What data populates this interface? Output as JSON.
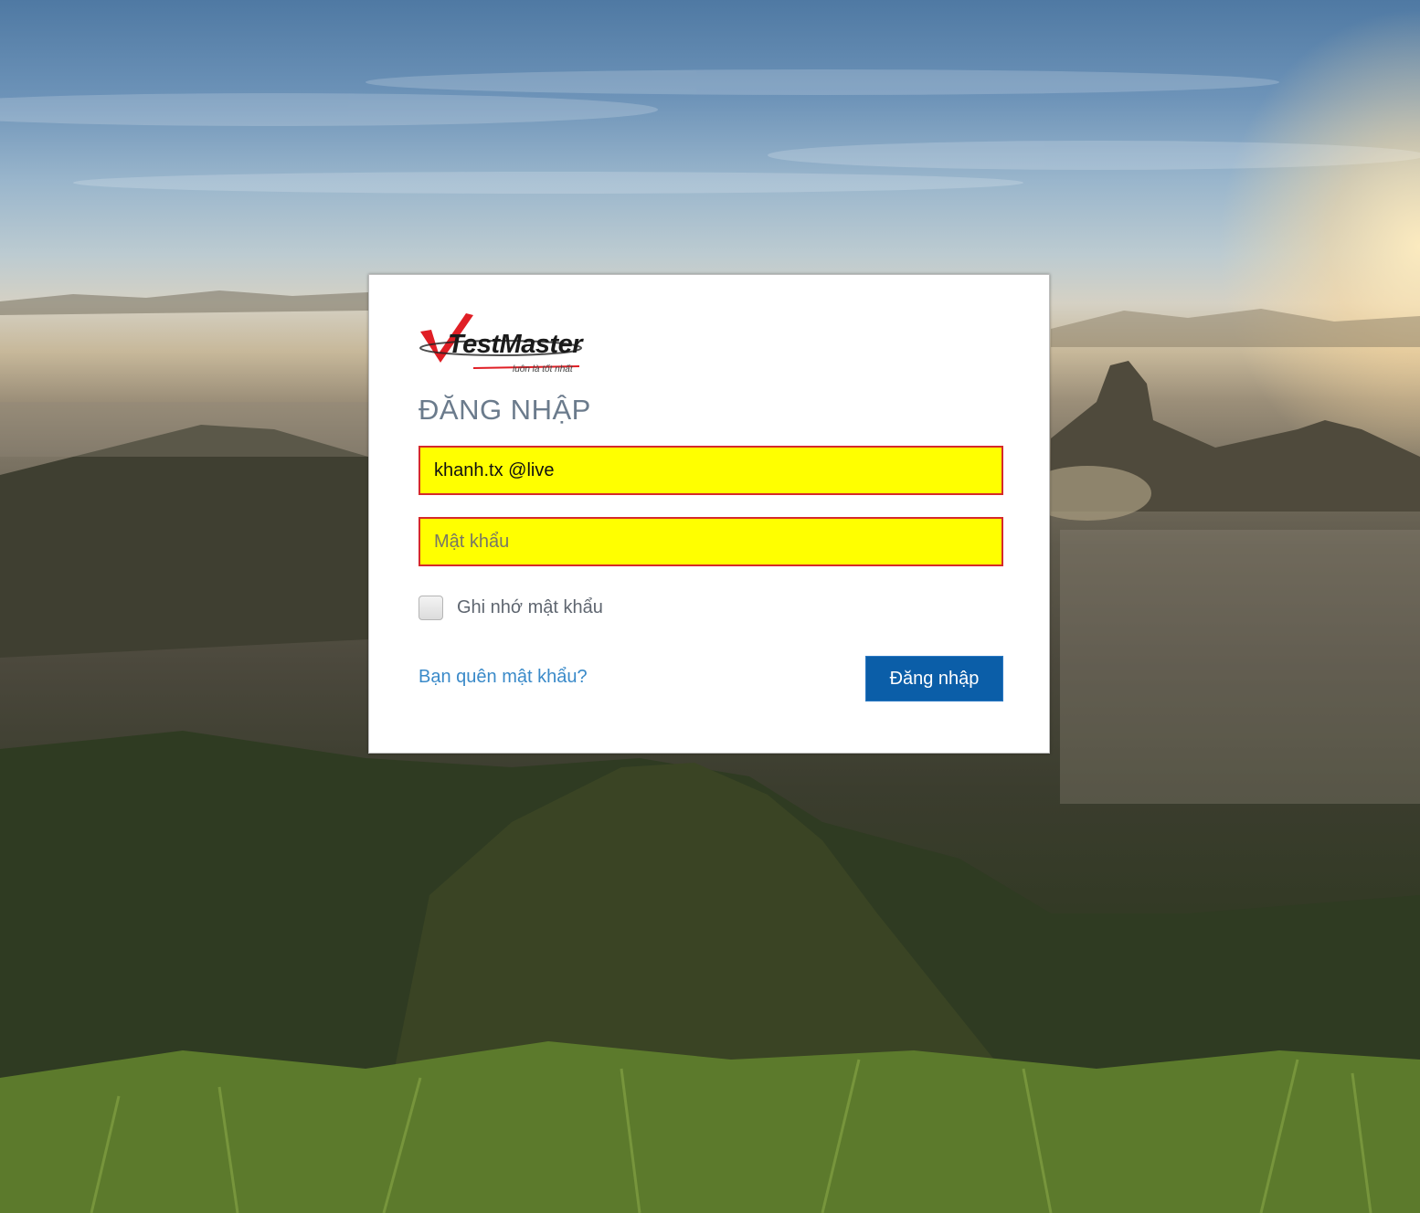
{
  "logo": {
    "brand": "TestMaster",
    "tagline": "luôn là tốt nhất"
  },
  "login": {
    "title": "ĐĂNG NHẬP",
    "username_value": "khanh.tx @live",
    "password_placeholder": "Mật khẩu",
    "remember_label": "Ghi nhớ mật khẩu",
    "forgot_label": "Bạn quên mật khẩu?",
    "submit_label": "Đăng nhập"
  },
  "colors": {
    "field_fill": "#ffff00",
    "field_border": "#d52a2a",
    "button": "#0b5ea8",
    "link": "#3a8ac9",
    "title": "#6b7b8c",
    "logo_red": "#e01e25"
  }
}
